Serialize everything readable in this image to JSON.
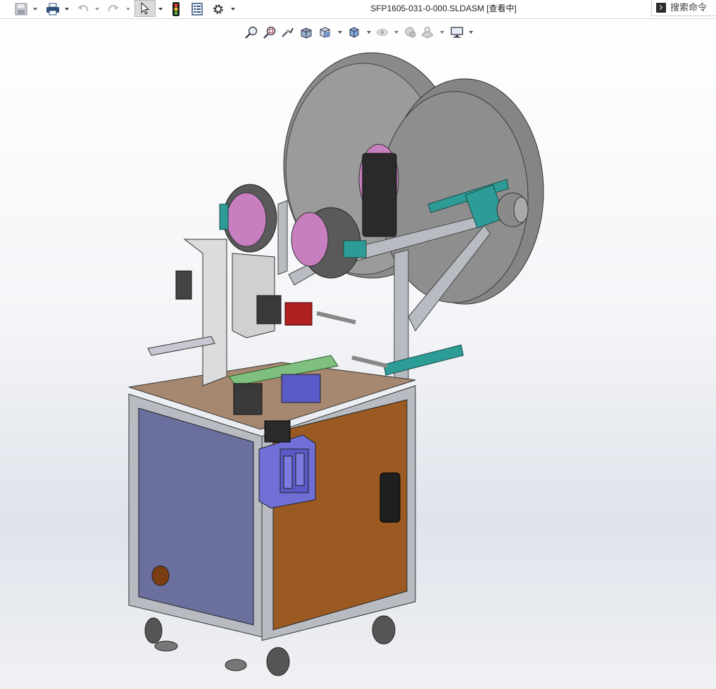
{
  "window": {
    "title": "SFP1605-031-0-000.SLDASM [查看中]"
  },
  "search": {
    "placeholder": "搜索命令",
    "icon": "command-prompt-icon"
  },
  "toolbar": {
    "items": [
      "save-icon",
      "print-icon",
      "undo-icon",
      "redo-icon",
      "select-arrow-icon",
      "rebuild-traffic-light-icon",
      "file-properties-icon",
      "options-gear-icon"
    ]
  },
  "heads_up_toolbar": {
    "items": [
      "zoom-to-fit-icon",
      "zoom-to-area-icon",
      "previous-view-icon",
      "section-view-icon",
      "view-orientation-icon",
      "display-style-icon",
      "hide-show-items-icon",
      "edit-appearance-icon",
      "apply-scene-icon",
      "view-settings-icon"
    ]
  },
  "colors": {
    "viewport_top": "#ffffff",
    "viewport_bottom": "#dfe3ea",
    "frame_aluminum": "#b8bcc2",
    "door_left": "#6a6f9e",
    "door_right": "#9a5a22",
    "reel": "#8a8a8a",
    "control_box": "#6f6fd6",
    "bracket_teal": "#2e9c96",
    "hub_pink": "#c77fbf",
    "tabletop": "#a68870"
  }
}
